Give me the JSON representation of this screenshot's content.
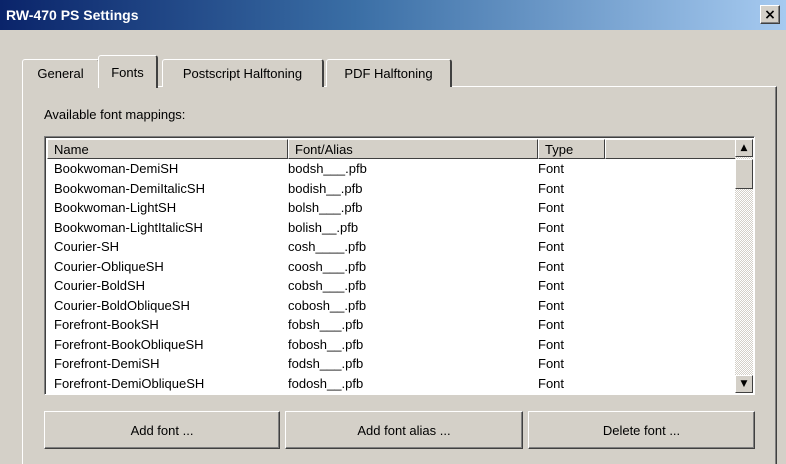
{
  "window": {
    "title": "RW-470 PS Settings",
    "close_glyph": "×"
  },
  "tabs": [
    {
      "label": "General",
      "active": false
    },
    {
      "label": "Fonts",
      "active": true
    },
    {
      "label": "Postscript Halftoning",
      "active": false
    },
    {
      "label": "PDF Halftoning",
      "active": false
    }
  ],
  "fonts_panel": {
    "available_label": "Available font mappings:",
    "columns": [
      "Name",
      "Font/Alias",
      "Type",
      ""
    ],
    "rows": [
      {
        "name": "Bookwoman-DemiSH",
        "alias": "bodsh___.pfb",
        "type": "Font"
      },
      {
        "name": "Bookwoman-DemiItalicSH",
        "alias": "bodish__.pfb",
        "type": "Font"
      },
      {
        "name": "Bookwoman-LightSH",
        "alias": "bolsh___.pfb",
        "type": "Font"
      },
      {
        "name": "Bookwoman-LightItalicSH",
        "alias": "bolish__.pfb",
        "type": "Font"
      },
      {
        "name": "Courier-SH",
        "alias": "cosh____.pfb",
        "type": "Font"
      },
      {
        "name": "Courier-ObliqueSH",
        "alias": "coosh___.pfb",
        "type": "Font"
      },
      {
        "name": "Courier-BoldSH",
        "alias": "cobsh___.pfb",
        "type": "Font"
      },
      {
        "name": "Courier-BoldObliqueSH",
        "alias": "cobosh__.pfb",
        "type": "Font"
      },
      {
        "name": "Forefront-BookSH",
        "alias": "fobsh___.pfb",
        "type": "Font"
      },
      {
        "name": "Forefront-BookObliqueSH",
        "alias": "fobosh__.pfb",
        "type": "Font"
      },
      {
        "name": "Forefront-DemiSH",
        "alias": "fodsh___.pfb",
        "type": "Font"
      },
      {
        "name": "Forefront-DemiObliqueSH",
        "alias": "fodosh__.pfb",
        "type": "Font"
      }
    ],
    "scroll_up_glyph": "▲",
    "scroll_down_glyph": "▼",
    "buttons": {
      "add_font": "Add font ...",
      "add_font_alias": "Add font alias ...",
      "delete_font": "Delete font ..."
    }
  }
}
